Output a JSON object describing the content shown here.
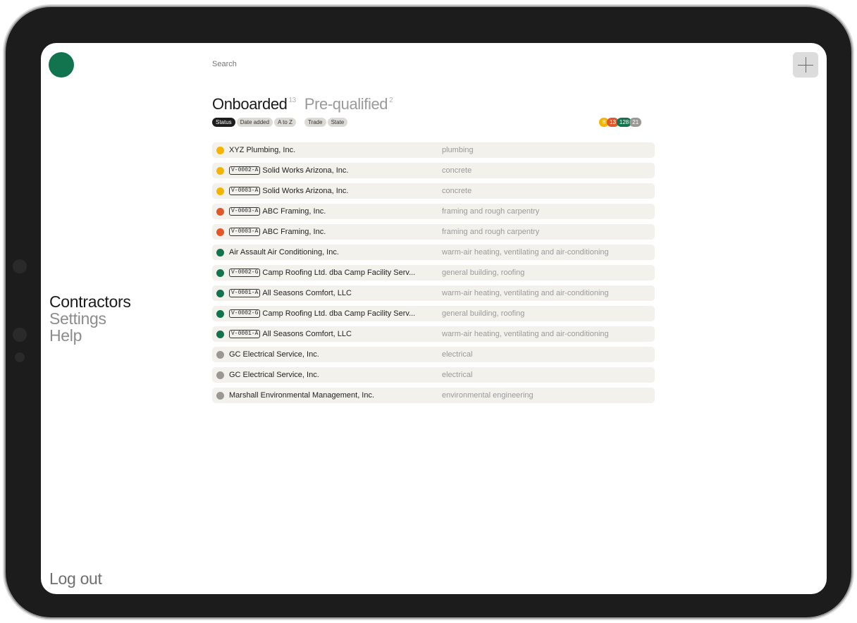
{
  "colors": {
    "brand": "#12744e",
    "amber": "#f4b400",
    "orange": "#e2572a",
    "green": "#12744e",
    "grey": "#9b9894"
  },
  "sidebar": {
    "items": [
      {
        "label": "Contractors",
        "active": true
      },
      {
        "label": "Settings",
        "active": false
      },
      {
        "label": "Help",
        "active": false
      }
    ],
    "logout": "Log out"
  },
  "search": {
    "placeholder": "Search"
  },
  "add_button": {
    "icon": "plus-icon"
  },
  "tabs": [
    {
      "label": "Onboarded",
      "count": "13",
      "active": true
    },
    {
      "label": "Pre-qualified",
      "count": "2",
      "active": false
    }
  ],
  "filters": [
    "Status",
    "Date added",
    "A to Z",
    "Trade",
    "State"
  ],
  "status_counts": [
    {
      "value": "8",
      "color": "#f4b400"
    },
    {
      "value": "13",
      "color": "#e2572a"
    },
    {
      "value": "128",
      "color": "#12744e"
    },
    {
      "value": "21",
      "color": "#9b9894"
    }
  ],
  "contractors": [
    {
      "status": "amber",
      "code": "",
      "name": "XYZ Plumbing, Inc.",
      "trade": "plumbing"
    },
    {
      "status": "amber",
      "code": "V-0002-A",
      "name": "Solid Works Arizona, Inc.",
      "trade": "concrete"
    },
    {
      "status": "amber",
      "code": "V-0003-A",
      "name": "Solid Works Arizona, Inc.",
      "trade": "concrete"
    },
    {
      "status": "orange",
      "code": "V-0003-A",
      "name": "ABC Framing, Inc.",
      "trade": "framing and rough carpentry"
    },
    {
      "status": "orange",
      "code": "V-0003-A",
      "name": "ABC Framing, Inc.",
      "trade": "framing and rough carpentry"
    },
    {
      "status": "green",
      "code": "",
      "name": "Air Assault Air Conditioning, Inc.",
      "trade": "warm-air heating, ventilating and air-conditioning"
    },
    {
      "status": "green",
      "code": "V-0002-G",
      "name": "Camp Roofing Ltd. dba Camp Facility Serv...",
      "trade": "general building, roofing"
    },
    {
      "status": "green",
      "code": "V-0001-A",
      "name": "All Seasons Comfort, LLC",
      "trade": "warm-air heating, ventilating and air-conditioning"
    },
    {
      "status": "green",
      "code": "V-0002-G",
      "name": "Camp Roofing Ltd. dba Camp Facility Serv...",
      "trade": "general building, roofing"
    },
    {
      "status": "green",
      "code": "V-0001-A",
      "name": "All Seasons Comfort, LLC",
      "trade": "warm-air heating, ventilating and air-conditioning"
    },
    {
      "status": "grey",
      "code": "",
      "name": "GC Electrical Service, Inc.",
      "trade": "electrical"
    },
    {
      "status": "grey",
      "code": "",
      "name": "GC Electrical Service, Inc.",
      "trade": "electrical"
    },
    {
      "status": "grey",
      "code": "",
      "name": "Marshall Environmental Management, Inc.",
      "trade": "environmental engineering"
    }
  ]
}
